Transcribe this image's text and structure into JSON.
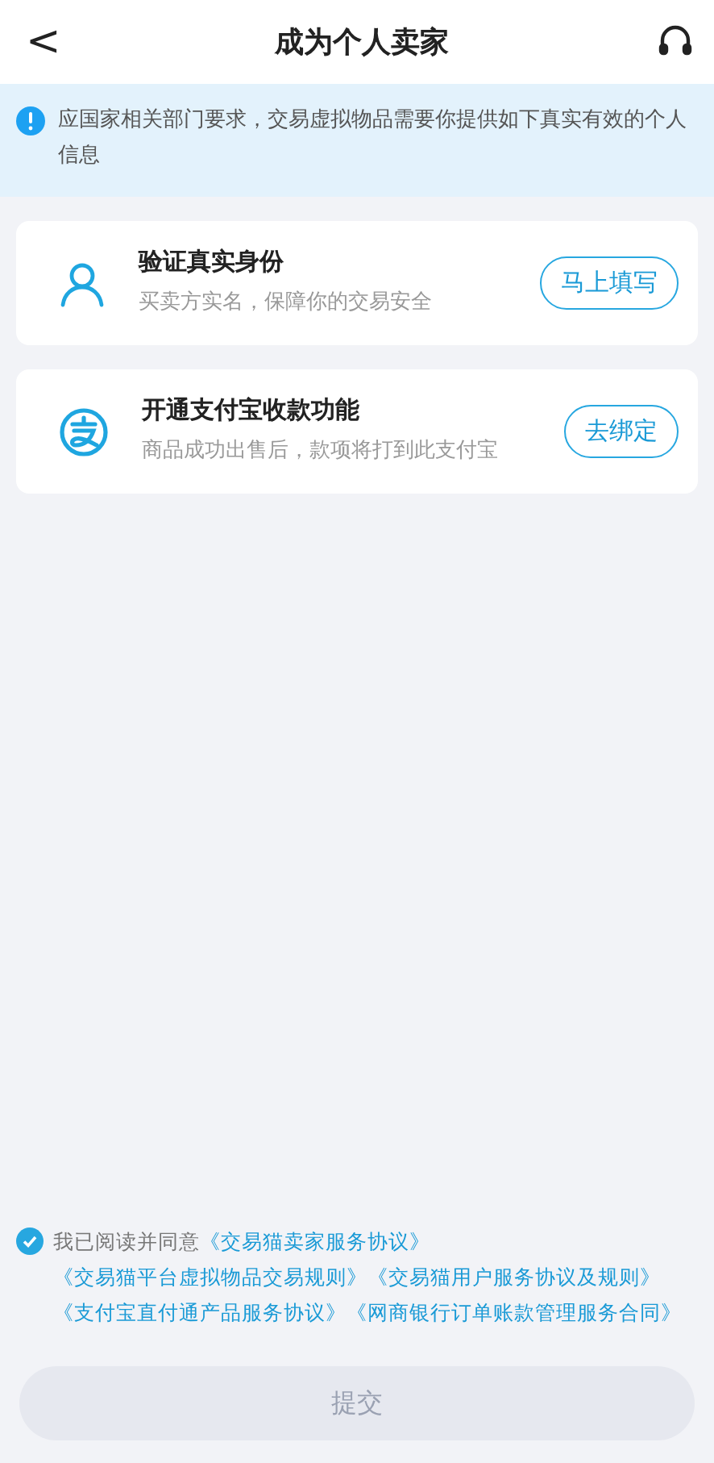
{
  "header": {
    "back": "<",
    "title": "成为个人卖家"
  },
  "notice": "应国家相关部门要求，交易虚拟物品需要你提供如下真实有效的个人信息",
  "tasks": [
    {
      "kind": "person",
      "title": "验证真实身份",
      "desc": "买卖方实名，保障你的交易安全",
      "action": "马上填写"
    },
    {
      "kind": "pay",
      "title": "开通支付宝收款功能",
      "desc": "商品成功出售后，款项将打到此支付宝",
      "action": "去绑定"
    }
  ],
  "agreement": {
    "checked": true,
    "prefix": "我已阅读并同意",
    "links": [
      "《交易猫卖家服务协议》",
      "《交易猫平台虚拟物品交易规则》",
      "《交易猫用户服务协议及规则》",
      "《支付宝直付通产品服务协议》",
      "《网商银行订单账款管理服务合同》"
    ]
  },
  "submit": {
    "label": "提交",
    "disabled": true
  }
}
